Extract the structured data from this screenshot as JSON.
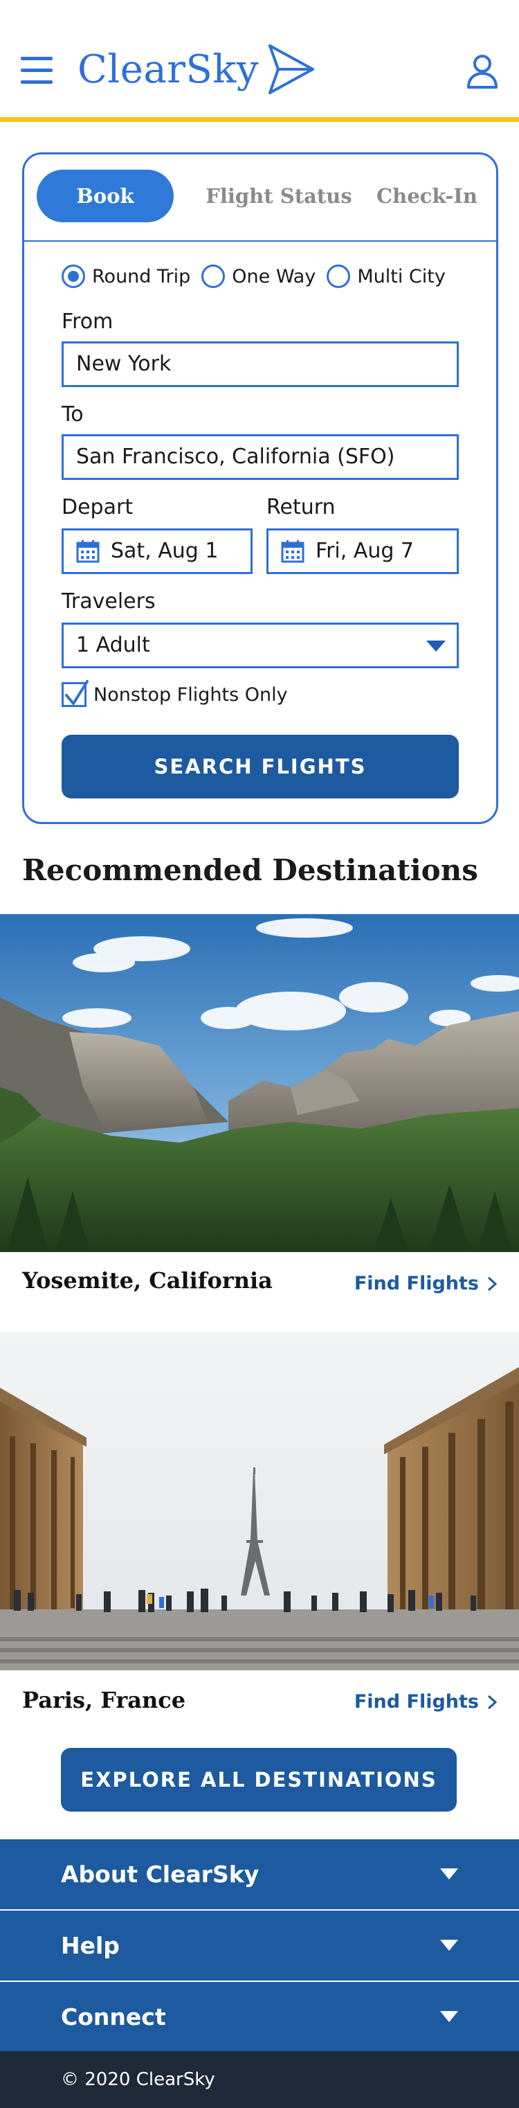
{
  "header": {
    "brand": "ClearSky",
    "brand_color": "#2f6fd8",
    "accent_color": "#f5c518",
    "menu_icon": "hamburger-menu-icon",
    "logo_icon": "paper-plane-icon",
    "account_icon": "user-icon"
  },
  "booking": {
    "tabs": [
      {
        "label": "Book",
        "active": true
      },
      {
        "label": "Flight Status",
        "active": false
      },
      {
        "label": "Check-In",
        "active": false
      }
    ],
    "trip_types": [
      {
        "label": "Round Trip",
        "checked": true
      },
      {
        "label": "One Way",
        "checked": false
      },
      {
        "label": "Multi City",
        "checked": false
      }
    ],
    "from": {
      "label": "From",
      "value": "New York"
    },
    "to": {
      "label": "To",
      "value": "San Francisco, California (SFO)"
    },
    "depart": {
      "label": "Depart",
      "value": "Sat, Aug 1"
    },
    "return": {
      "label": "Return",
      "value": "Fri, Aug 7"
    },
    "travelers": {
      "label": "Travelers",
      "value": "1 Adult"
    },
    "nonstop": {
      "label": "Nonstop Flights Only",
      "checked": true
    },
    "search_label": "SEARCH FLIGHTS"
  },
  "recommended": {
    "title": "Recommended Destinations",
    "destinations": [
      {
        "name": "Yosemite, California",
        "link": "Find Flights"
      },
      {
        "name": "Paris, France",
        "link": "Find Flights"
      }
    ],
    "explore_label": "EXPLORE ALL DESTINATIONS"
  },
  "footer": {
    "sections": [
      {
        "label": "About ClearSky"
      },
      {
        "label": "Help"
      },
      {
        "label": "Connect"
      }
    ],
    "copyright": "© 2020 ClearSky",
    "primary_color": "#1d5aa0",
    "dark_color": "#1e2a38"
  }
}
